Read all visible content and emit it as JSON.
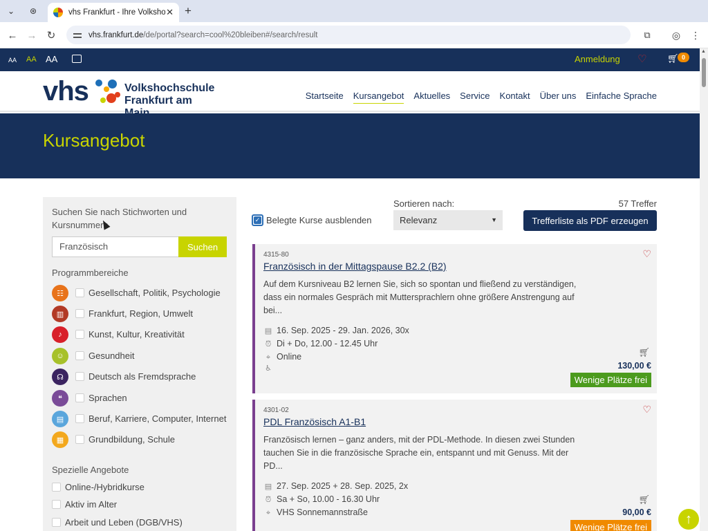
{
  "browser": {
    "tab_title": "vhs Frankfurt - Ihre Volkshochschule",
    "url_domain": "vhs.frankfurt.de",
    "url_path": "/de/portal?search=cool%20bleiben#/search/result"
  },
  "sitebar": {
    "font_small": "AA",
    "font_medium": "AA",
    "font_large": "AA",
    "login": "Anmeldung",
    "cart_count": "0"
  },
  "header": {
    "logo_vhs": "vhs",
    "logo_line1": "Volkshochschule",
    "logo_line2": "Frankfurt am Main",
    "nav": [
      "Startseite",
      "Kursangebot",
      "Aktuelles",
      "Service",
      "Kontakt",
      "Über uns",
      "Einfache Sprache"
    ]
  },
  "hero": {
    "title": "Kursangebot"
  },
  "sidebar": {
    "search_label": "Suchen Sie nach Stichworten und Kursnummern",
    "search_value": "Französisch",
    "search_button": "Suchen",
    "programs_heading": "Programmbereiche",
    "programs": [
      {
        "label": "Gesellschaft, Politik, Psychologie",
        "color": "#e8731a"
      },
      {
        "label": "Frankfurt, Region, Umwelt",
        "color": "#b23a26"
      },
      {
        "label": "Kunst, Kultur, Kreativität",
        "color": "#d8202a"
      },
      {
        "label": "Gesundheit",
        "color": "#a7c12a"
      },
      {
        "label": "Deutsch als Fremdsprache",
        "color": "#3b2460"
      },
      {
        "label": "Sprachen",
        "color": "#7a4b98"
      },
      {
        "label": "Beruf, Karriere, Computer, Internet",
        "color": "#5aa6dc"
      },
      {
        "label": "Grundbildung, Schule",
        "color": "#f3a81d"
      }
    ],
    "special_heading": "Spezielle Angebote",
    "special": [
      "Online-/Hybridkurse",
      "Aktiv im Alter",
      "Arbeit und Leben (DGB/VHS)"
    ]
  },
  "results": {
    "hide_booked": "Belegte Kurse ausblenden",
    "sort_label": "Sortieren nach:",
    "sort_value": "Relevanz",
    "hits": "57 Treffer",
    "pdf_button": "Trefferliste als PDF erzeugen",
    "courses": [
      {
        "number": "4315-80",
        "title": "Französisch in der Mittagspause B2.2 (B2)",
        "description": "Auf dem Kursniveau B2 lernen Sie, sich so spontan und fließend zu verständigen, dass ein normales Gespräch mit Muttersprachlern ohne größere Anstrengung auf bei...",
        "dates": "16. Sep. 2025 - 29. Jan. 2026, 30x",
        "time": "Di + Do, 12.00 - 12.45 Uhr",
        "location": "Online",
        "price": "130,00 €",
        "availability": "Wenige Plätze frei",
        "availability_color": "#4c9b1e"
      },
      {
        "number": "4301-02",
        "title": "PDL Französisch A1-B1",
        "description": "Französisch lernen – ganz anders, mit der PDL-Methode. In diesen zwei Stunden tauchen Sie in die französische Sprache ein, entspannt und mit Genuss. Mit der PD...",
        "dates": "27. Sep. 2025 + 28. Sep. 2025, 2x",
        "time": "Sa + So, 10.00 - 16.30 Uhr",
        "location": "VHS Sonnemannstraße",
        "price": "90,00 €",
        "availability": "Wenige Plätze frei",
        "availability_color": "#f08a00"
      }
    ]
  }
}
